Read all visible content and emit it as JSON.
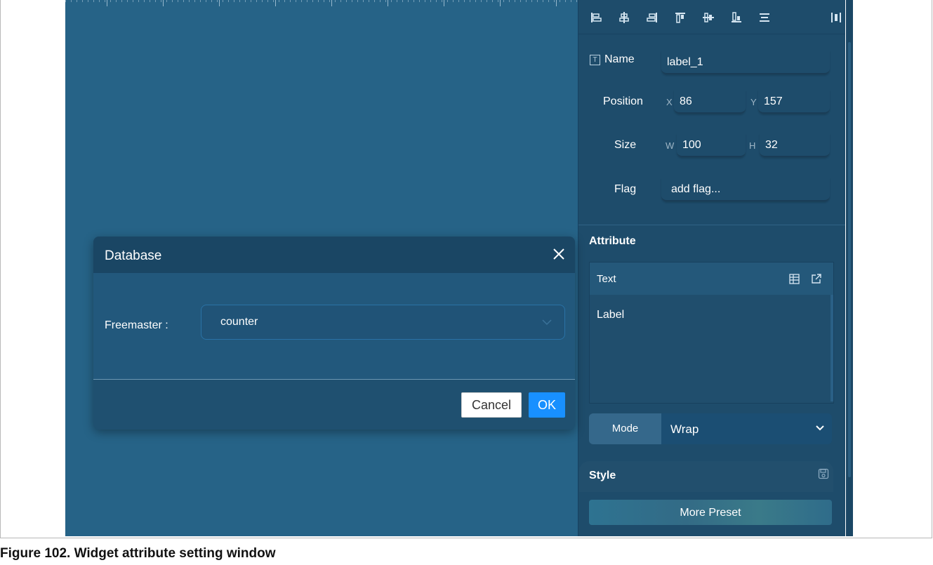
{
  "toolbar": {
    "icons": [
      "align-left-icon",
      "align-center-horizontal-icon",
      "align-right-icon",
      "align-top-icon",
      "align-center-vertical-icon",
      "align-bottom-icon",
      "distribute-horizontal-icon",
      "distribute-vertical-icon"
    ]
  },
  "properties": {
    "name_label": "Name",
    "name_value": "label_1",
    "position_label": "Position",
    "x_label": "X",
    "x_value": "86",
    "y_label": "Y",
    "y_value": "157",
    "size_label": "Size",
    "w_label": "W",
    "w_value": "100",
    "h_label": "H",
    "h_value": "32",
    "flag_label": "Flag",
    "flag_value": "add flag..."
  },
  "attribute": {
    "title": "Attribute",
    "text_header": "Text",
    "text_value": "Label",
    "mode_label": "Mode",
    "mode_value": "Wrap"
  },
  "style": {
    "title": "Style",
    "preset_button": "More Preset"
  },
  "dialog": {
    "title": "Database",
    "field_label": "Freemaster :",
    "field_value": "counter",
    "cancel_label": "Cancel",
    "ok_label": "OK"
  },
  "caption": "Figure 102.  Widget attribute setting window"
}
